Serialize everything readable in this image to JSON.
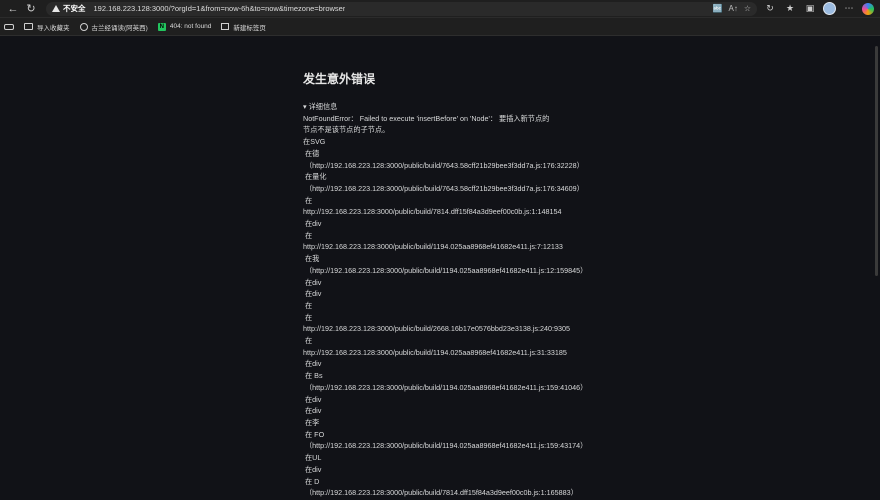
{
  "browser": {
    "security_label": "不安全",
    "url": "192.168.223.128:3000/?orgId=1&from=now-6h&to=now&timezone=browser",
    "icons": [
      "back-icon",
      "refresh-icon",
      "translate-icon",
      "read-aloud-icon",
      "favorite-icon",
      "extensions-icon",
      "favorites-bar-icon",
      "profile-icon",
      "copilot-icon"
    ]
  },
  "bookmarks": [
    {
      "label": "导入收藏夹",
      "icon": "folder-icon"
    },
    {
      "label": "古兰经诵读(阿英西)",
      "icon": "globe-icon"
    },
    {
      "label": "404: not found",
      "icon": "n-icon"
    },
    {
      "label": "新建标签页",
      "icon": "tab-icon"
    }
  ],
  "error": {
    "title": "发生意外错误",
    "summary": "▾ 详细信息",
    "lines": [
      "NotFoundError： Failed to execute 'insertBefore' on 'Node'： 要插入新节点的",
      "节点不是该节点的子节点。",
      "在SVG",
      " 在德",
      " （http://192.168.223.128:3000/public/build/7643.58cff21b29bee3f3dd7a.js:176:32228）",
      " 在量化",
      " （http://192.168.223.128:3000/public/build/7643.58cff21b29bee3f3dd7a.js:176:34609）",
      " 在",
      "http://192.168.223.128:3000/public/build/7814.dff15f84a3d9eef00c0b.js:1:148154",
      " 在div",
      " 在",
      "http://192.168.223.128:3000/public/build/1194.025aa8968ef41682e411.js:7:12133",
      " 在我",
      " （http://192.168.223.128:3000/public/build/1194.025aa8968ef41682e411.js:12:159845）",
      " 在div",
      " 在div",
      " 在",
      " 在",
      "http://192.168.223.128:3000/public/build/2668.16b17e0576bbd23e3138.js:240:9305",
      " 在",
      "http://192.168.223.128:3000/public/build/1194.025aa8968ef41682e411.js:31:33185",
      " 在div",
      " 在 Bs",
      " （http://192.168.223.128:3000/public/build/1194.025aa8968ef41682e411.js:159:41046）",
      " 在div",
      " 在div",
      " 在李",
      " 在 FO",
      " （http://192.168.223.128:3000/public/build/1194.025aa8968ef41682e411.js:159:43174）",
      " 在UL",
      " 在div",
      " 在 D",
      " （http://192.168.223.128:3000/public/build/7814.dff15f84a3d9eef00c0b.js:1:165883）"
    ]
  }
}
